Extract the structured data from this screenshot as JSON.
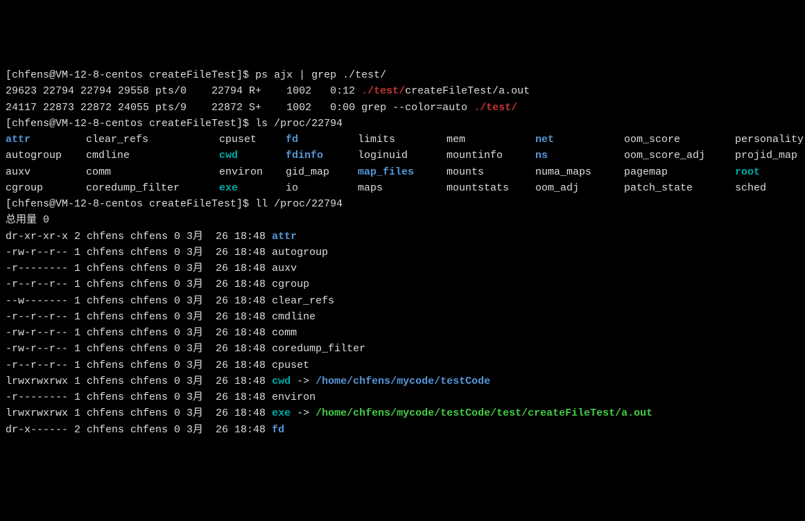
{
  "prompt1": {
    "full": "[chfens@VM-12-8-centos createFileTest]$ ",
    "cmd": "ps ajx | grep ./test/"
  },
  "ps": {
    "row1": {
      "cols": "29623 22794 22794 29558 pts/0    22794 R+    1002   0:12 ",
      "hl": "./test/",
      "rest": "createFileTest/a.out"
    },
    "row2": {
      "cols": "24117 22873 22872 24055 pts/9    22872 S+    1002   0:00 ",
      "mid": "grep --color=auto ",
      "hl": "./test/"
    }
  },
  "prompt2": {
    "cmd": "ls /proc/22794"
  },
  "ls": {
    "cols": [
      [
        "attr",
        "autogroup",
        "auxv",
        "cgroup"
      ],
      [
        "clear_refs",
        "cmdline",
        "comm",
        "coredump_filter"
      ],
      [
        "cpuset",
        "cwd",
        "environ",
        "exe"
      ],
      [
        "fd",
        "fdinfo",
        "gid_map",
        "io"
      ],
      [
        "limits",
        "loginuid",
        "map_files",
        "maps"
      ],
      [
        "mem",
        "mountinfo",
        "mounts",
        "mountstats"
      ],
      [
        "net",
        "ns",
        "numa_maps",
        "oom_adj"
      ],
      [
        "oom_score",
        "oom_score_adj",
        "pagemap",
        "patch_state"
      ],
      [
        "personality",
        "projid_map",
        "root",
        "sched"
      ]
    ],
    "widths": [
      116,
      192,
      96,
      104,
      128,
      128,
      128,
      160,
      160
    ],
    "classes": {
      "attr": "brightBlue bold",
      "cwd": "cyan bold",
      "exe": "cyan bold",
      "fd": "brightBlue bold",
      "fdinfo": "brightBlue bold",
      "map_files": "brightBlue bold",
      "net": "brightBlue bold",
      "ns": "brightBlue bold",
      "root": "cyan bold"
    }
  },
  "prompt3": {
    "cmd": "ll /proc/22794"
  },
  "total_line": "总用量 0",
  "ll": [
    {
      "perm": "dr-xr-xr-x",
      "links": "2",
      "user": "chfens",
      "group": "chfens",
      "size": "0",
      "mon": "3月",
      "day": "26",
      "time": "18:48",
      "name": "attr",
      "cls": "brightBlue bold"
    },
    {
      "perm": "-rw-r--r--",
      "links": "1",
      "user": "chfens",
      "group": "chfens",
      "size": "0",
      "mon": "3月",
      "day": "26",
      "time": "18:48",
      "name": "autogroup"
    },
    {
      "perm": "-r--------",
      "links": "1",
      "user": "chfens",
      "group": "chfens",
      "size": "0",
      "mon": "3月",
      "day": "26",
      "time": "18:48",
      "name": "auxv"
    },
    {
      "perm": "-r--r--r--",
      "links": "1",
      "user": "chfens",
      "group": "chfens",
      "size": "0",
      "mon": "3月",
      "day": "26",
      "time": "18:48",
      "name": "cgroup"
    },
    {
      "perm": "--w-------",
      "links": "1",
      "user": "chfens",
      "group": "chfens",
      "size": "0",
      "mon": "3月",
      "day": "26",
      "time": "18:48",
      "name": "clear_refs"
    },
    {
      "perm": "-r--r--r--",
      "links": "1",
      "user": "chfens",
      "group": "chfens",
      "size": "0",
      "mon": "3月",
      "day": "26",
      "time": "18:48",
      "name": "cmdline"
    },
    {
      "perm": "-rw-r--r--",
      "links": "1",
      "user": "chfens",
      "group": "chfens",
      "size": "0",
      "mon": "3月",
      "day": "26",
      "time": "18:48",
      "name": "comm"
    },
    {
      "perm": "-rw-r--r--",
      "links": "1",
      "user": "chfens",
      "group": "chfens",
      "size": "0",
      "mon": "3月",
      "day": "26",
      "time": "18:48",
      "name": "coredump_filter"
    },
    {
      "perm": "-r--r--r--",
      "links": "1",
      "user": "chfens",
      "group": "chfens",
      "size": "0",
      "mon": "3月",
      "day": "26",
      "time": "18:48",
      "name": "cpuset"
    },
    {
      "perm": "lrwxrwxrwx",
      "links": "1",
      "user": "chfens",
      "group": "chfens",
      "size": "0",
      "mon": "3月",
      "day": "26",
      "time": "18:48",
      "name": "cwd",
      "cls": "cyan bold",
      "arrow": " -> ",
      "target": "/home/chfens/mycode/testCode",
      "tcls": "brightBlue bold"
    },
    {
      "perm": "-r--------",
      "links": "1",
      "user": "chfens",
      "group": "chfens",
      "size": "0",
      "mon": "3月",
      "day": "26",
      "time": "18:48",
      "name": "environ"
    },
    {
      "perm": "lrwxrwxrwx",
      "links": "1",
      "user": "chfens",
      "group": "chfens",
      "size": "0",
      "mon": "3月",
      "day": "26",
      "time": "18:48",
      "name": "exe",
      "cls": "cyan bold",
      "arrow": " -> ",
      "target": "/home/chfens/mycode/testCode/test/createFileTest/a.out",
      "tcls": "brightGreen bold"
    },
    {
      "perm": "dr-x------",
      "links": "2",
      "user": "chfens",
      "group": "chfens",
      "size": "0",
      "mon": "3月",
      "day": "26",
      "time": "18:48",
      "name": "fd",
      "cls": "brightBlue bold"
    }
  ]
}
